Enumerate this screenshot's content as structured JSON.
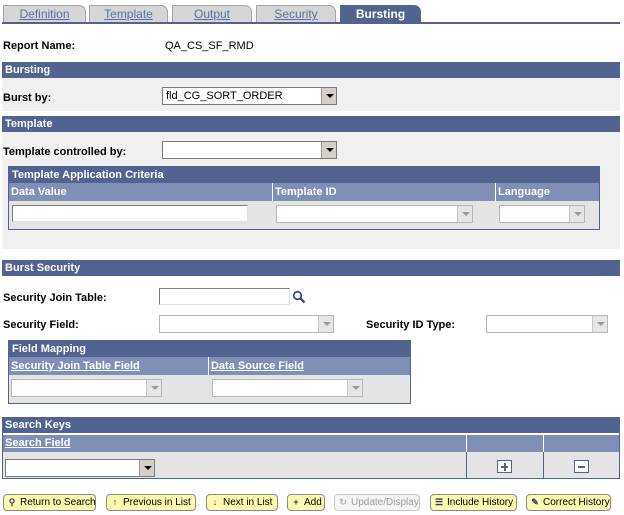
{
  "tabs": [
    {
      "label": "Definition",
      "active": false
    },
    {
      "label": "Template",
      "active": false
    },
    {
      "label": "Output",
      "active": false
    },
    {
      "label": "Security",
      "active": false
    },
    {
      "label": "Bursting",
      "active": true
    }
  ],
  "report": {
    "label": "Report Name:",
    "value": "QA_CS_SF_RMD"
  },
  "bursting": {
    "title": "Bursting",
    "burst_by_label": "Burst by:",
    "burst_by_value": "fld_CG_SORT_ORDER"
  },
  "template": {
    "title": "Template",
    "controlled_by_label": "Template controlled by:",
    "controlled_by_value": "",
    "criteria": {
      "title": "Template Application Criteria",
      "columns": [
        "Data Value",
        "Template ID",
        "Language"
      ],
      "row": {
        "data_value": "",
        "template_id": "",
        "language": ""
      }
    }
  },
  "burst_security": {
    "title": "Burst Security",
    "join_table_label": "Security Join Table:",
    "join_table_value": "",
    "field_label": "Security Field:",
    "field_value": "",
    "id_type_label": "Security ID Type:",
    "id_type_value": "",
    "mapping": {
      "title": "Field Mapping",
      "columns": [
        "Security Join Table Field",
        "Data Source Field"
      ],
      "row": {
        "join_field": "",
        "source_field": ""
      }
    }
  },
  "search_keys": {
    "title": "Search Keys",
    "column": "Search Field",
    "row": {
      "search_field": ""
    }
  },
  "toolbar": {
    "return": "Return to Search",
    "previous": "Previous in List",
    "next": "Next in List",
    "add": "Add",
    "update": "Update/Display",
    "include_history": "Include History",
    "correct_history": "Correct History"
  },
  "colors": {
    "accent": "#51638e",
    "grid_header": "#7f8fb6",
    "button_bg": "#fff9b0"
  }
}
